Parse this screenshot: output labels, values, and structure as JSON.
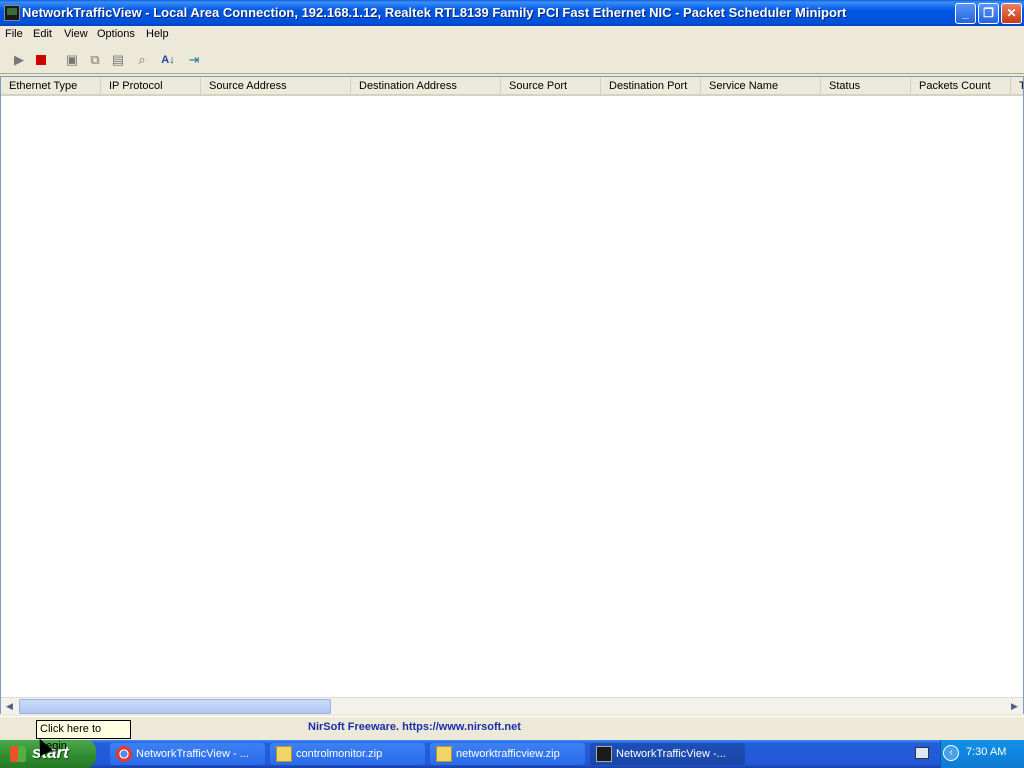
{
  "window": {
    "title": "NetworkTrafficView  -  Local Area Connection, 192.168.1.12, Realtek RTL8139 Family PCI Fast Ethernet NIC - Packet Scheduler Miniport"
  },
  "menu": [
    "File",
    "Edit",
    "View",
    "Options",
    "Help"
  ],
  "toolbar": {
    "icons": [
      "play-icon",
      "stop-icon",
      "save-icon",
      "copy-icon",
      "properties-icon",
      "find-icon",
      "sort-icon",
      "exit-icon"
    ]
  },
  "table": {
    "columns": [
      "Ethernet Type",
      "IP Protocol",
      "Source Address",
      "Destination Address",
      "Source Port",
      "Destination Port",
      "Service Name",
      "Status",
      "Packets Count",
      "T"
    ]
  },
  "statusbar": {
    "link": "NirSoft Freeware. https://www.nirsoft.net"
  },
  "tooltip": "Click here to begin",
  "taskbar": {
    "start": "start",
    "tasks": [
      "NetworkTrafficView - ...",
      "controlmonitor.zip",
      "networktrafficview.zip",
      "NetworkTrafficView  -..."
    ],
    "clock": "7:30 AM"
  },
  "colors": {
    "titlebar": "#0058e6",
    "taskbar": "#245edb",
    "start": "#2f8a2f",
    "link": "#1a2ea8"
  }
}
